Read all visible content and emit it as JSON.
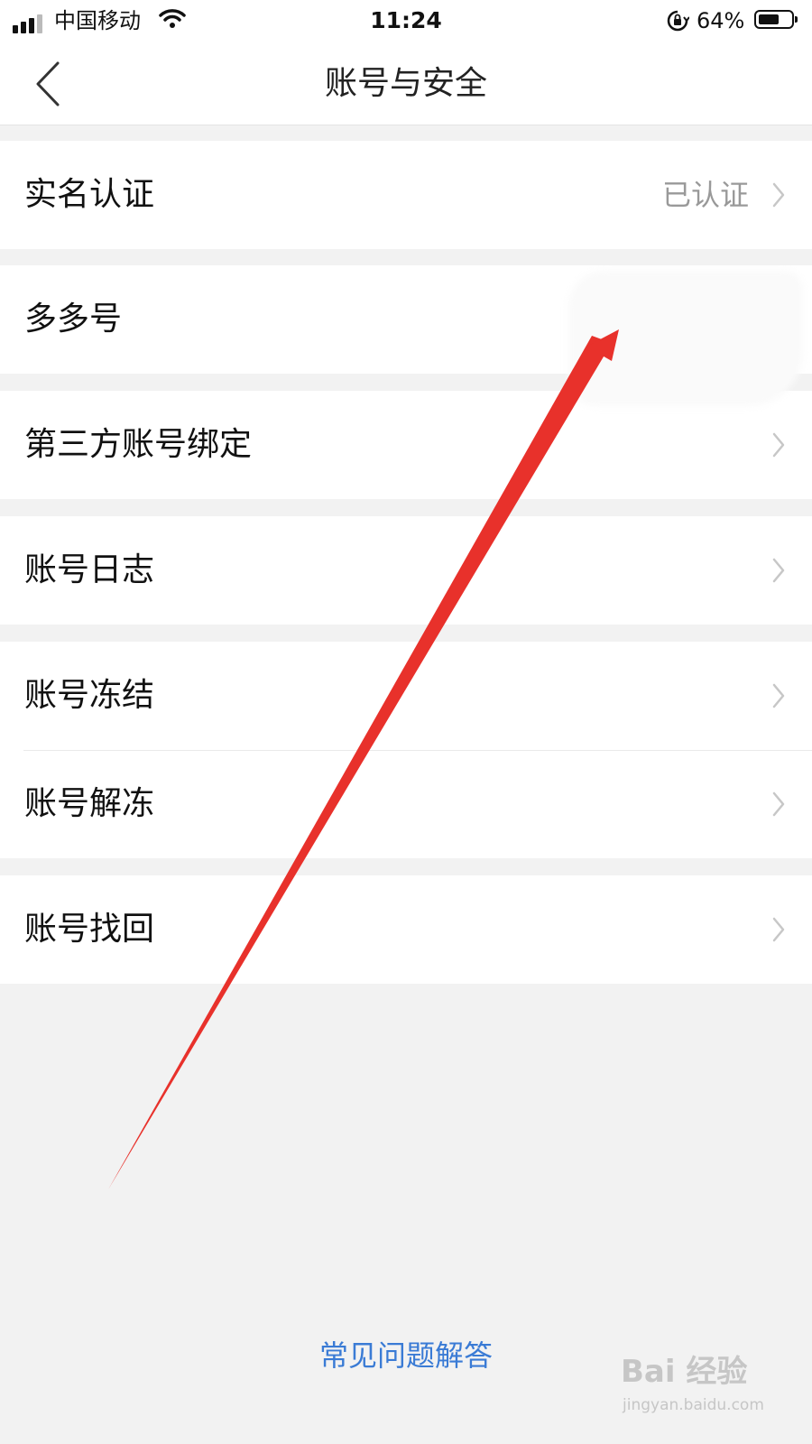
{
  "status_bar": {
    "carrier": "中国移动",
    "time": "11:24",
    "battery": "64%",
    "battery_level": 0.64
  },
  "nav": {
    "title": "账号与安全"
  },
  "rows": [
    {
      "label": "实名认证",
      "value": "已认证"
    },
    {
      "label": "多多号"
    },
    {
      "label": "第三方账号绑定"
    },
    {
      "label": "账号日志"
    },
    {
      "label": "账号冻结"
    },
    {
      "label": "账号解冻"
    },
    {
      "label": "账号找回"
    }
  ],
  "footer": {
    "faq_link": "常见问题解答"
  },
  "watermark": {
    "logo_text": "Bai 经验",
    "url": "jingyan.baidu.com"
  },
  "colors": {
    "link": "#3a7bd5",
    "annotation_arrow": "#e8312b",
    "page_background": "#f2f2f2"
  }
}
